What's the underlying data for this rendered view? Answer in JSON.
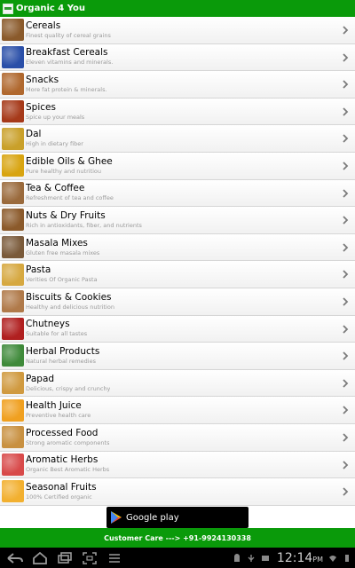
{
  "app": {
    "title": "Organic 4 You"
  },
  "categories": [
    {
      "name": "Cereals",
      "sub": "Finest quality of cereal grains",
      "color": "#8a5a2b"
    },
    {
      "name": "Breakfast Cereals",
      "sub": "Eleven vitamins and minerals.",
      "color": "#2a4fa8"
    },
    {
      "name": "Snacks",
      "sub": "More fat protein & minerals.",
      "color": "#b0682e"
    },
    {
      "name": "Spices",
      "sub": "Spice up your meals",
      "color": "#a63a1a"
    },
    {
      "name": "Dal",
      "sub": "High in dietary fiber",
      "color": "#c9a02a"
    },
    {
      "name": "Edible Oils & Ghee",
      "sub": "Pure healthy and nutritiou",
      "color": "#d8a410"
    },
    {
      "name": "Tea & Coffee",
      "sub": "Refreshment of tea and coffee",
      "color": "#9a6a3c"
    },
    {
      "name": "Nuts & Dry Fruits",
      "sub": "Rich in antioxidants, fiber, and nutrients",
      "color": "#8b5a2b"
    },
    {
      "name": "Masala Mixes",
      "sub": "Gluten free  masala mixes",
      "color": "#7a5a3a"
    },
    {
      "name": "Pasta",
      "sub": "Verities Of Organic Pasta",
      "color": "#d6a840"
    },
    {
      "name": "Biscuits & Cookies",
      "sub": "Healthy and delicious nutrition",
      "color": "#b07a4a"
    },
    {
      "name": "Chutneys",
      "sub": "Suitable for all tastes",
      "color": "#b02020"
    },
    {
      "name": "Herbal Products",
      "sub": "Natural herbal remedies",
      "color": "#3f8a3a"
    },
    {
      "name": "Papad",
      "sub": "Delicious, crispy and crunchy",
      "color": "#d09a40"
    },
    {
      "name": "Health Juice",
      "sub": "Preventive health care",
      "color": "#f0a020"
    },
    {
      "name": "Processed Food",
      "sub": "Strong aromatic components",
      "color": "#c89040"
    },
    {
      "name": "Aromatic Herbs",
      "sub": "Organic Best Aromatic Herbs",
      "color": "#d84a4a"
    },
    {
      "name": "Seasonal Fruits",
      "sub": "100% Certified organic",
      "color": "#f2b030"
    }
  ],
  "ad": {
    "label": "Google play"
  },
  "footer": {
    "customer_care": "Customer Care ---> +91-9924130338"
  },
  "statusbar": {
    "time": "12:14",
    "ampm": "PM"
  }
}
